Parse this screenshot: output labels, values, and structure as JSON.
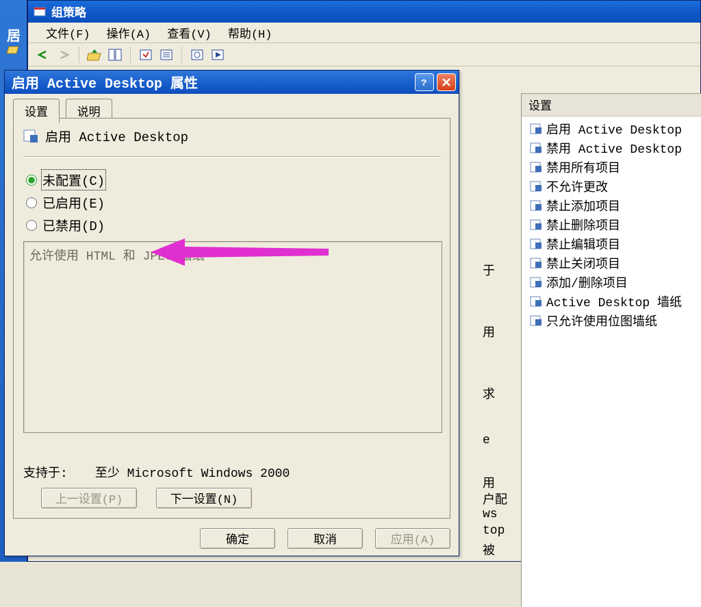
{
  "left_stripe": {
    "top_char": "居"
  },
  "app": {
    "title": "组策略",
    "menus": {
      "file": "文件(F)",
      "action": "操作(A)",
      "view": "查看(V)",
      "help": "帮助(H)"
    }
  },
  "right_pane": {
    "header": "设置",
    "items": [
      "启用 Active Desktop",
      "禁用 Active Desktop",
      "禁用所有项目",
      "不允许更改",
      "禁止添加项目",
      "禁止删除项目",
      "禁止编辑项目",
      "禁止关闭项目",
      "添加/删除项目",
      "Active Desktop 墙纸",
      "只允许使用位图墙纸"
    ]
  },
  "bg_text": {
    "a": "于",
    "b": "用",
    "c": "求",
    "d": "e",
    "e": "用",
    "f": "户配",
    "g": "ws",
    "h": "top",
    "i": "被"
  },
  "dialog": {
    "title": "启用 Active Desktop 属性",
    "tabs": {
      "settings": "设置",
      "explain": "说明"
    },
    "policy_name": "启用 Active Desktop",
    "radios": {
      "not_configured": "未配置(C)",
      "enabled": "已启用(E)",
      "disabled": "已禁用(D)"
    },
    "description": "允许使用 HTML 和 JPEG 墙纸",
    "supported_label": "支持于:",
    "supported_value": "至少 Microsoft Windows 2000",
    "nav": {
      "prev": "上一设置(P)",
      "next": "下一设置(N)"
    },
    "buttons": {
      "ok": "确定",
      "cancel": "取消",
      "apply": "应用(A)"
    }
  }
}
